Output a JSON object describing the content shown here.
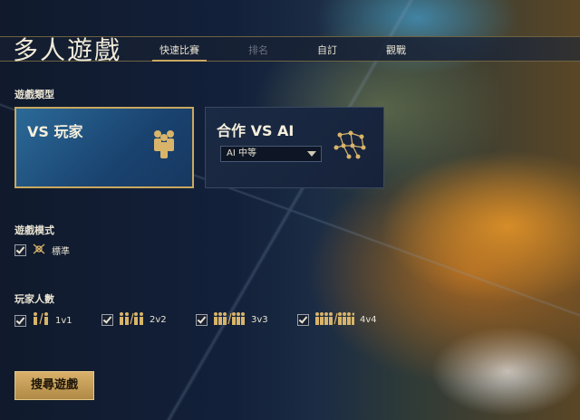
{
  "header": {
    "title": "多人遊戲"
  },
  "tabs": [
    {
      "label": "快速比賽",
      "state": "active"
    },
    {
      "label": "排名",
      "state": "disabled"
    },
    {
      "label": "自訂",
      "state": "normal"
    },
    {
      "label": "觀戰",
      "state": "normal"
    }
  ],
  "game_type": {
    "label": "遊戲類型",
    "cards": [
      {
        "title": "VS 玩家",
        "selected": true,
        "icon": "players-group-icon"
      },
      {
        "title": "合作 VS AI",
        "selected": false,
        "icon": "ai-network-icon",
        "select_value": "AI 中等"
      }
    ]
  },
  "game_mode": {
    "label": "遊戲模式",
    "options": [
      {
        "label": "標準",
        "checked": true,
        "icon": "standard-mode-icon"
      }
    ]
  },
  "player_count": {
    "label": "玩家人數",
    "options": [
      {
        "label": "1v1",
        "checked": true
      },
      {
        "label": "2v2",
        "checked": true
      },
      {
        "label": "3v3",
        "checked": true
      },
      {
        "label": "4v4",
        "checked": true
      }
    ]
  },
  "actions": {
    "search_label": "搜尋遊戲"
  },
  "colors": {
    "accent": "#c9a860",
    "selected_card": "#2b6a98",
    "background": "#0d1524"
  }
}
